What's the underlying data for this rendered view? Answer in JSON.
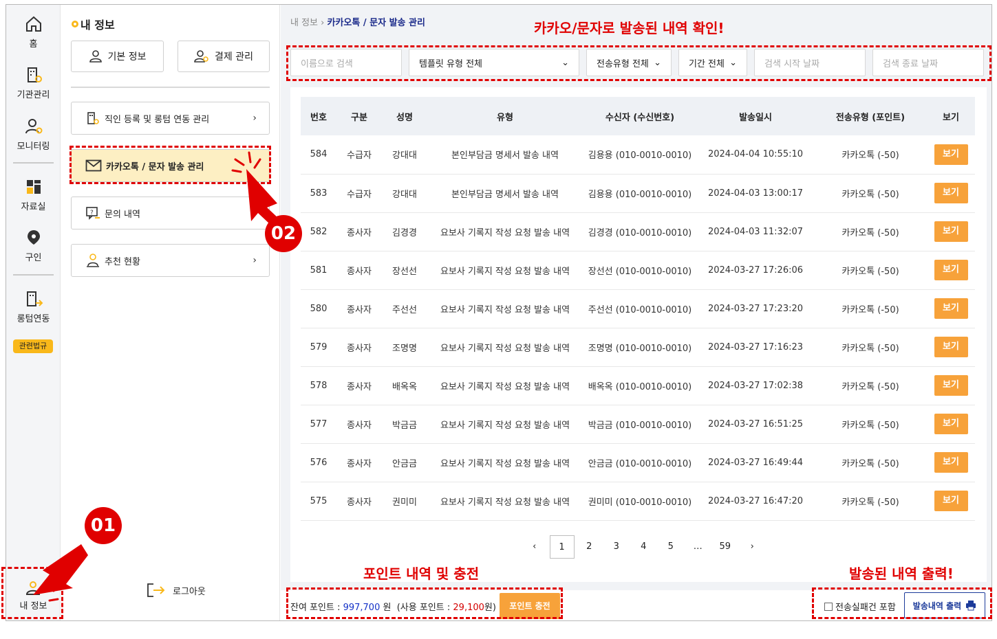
{
  "nav": {
    "home": "홈",
    "institution": "기관관리",
    "monitoring": "모니터링",
    "archive": "자료실",
    "jobs": "구인",
    "ltc_link": "롱텀연동",
    "law_badge": "관련법규",
    "my_info": "내 정보"
  },
  "side": {
    "title": "내 정보",
    "basic_info": "기본 정보",
    "payment": "결제 관리",
    "menu": [
      "직인 등록 및 롱텀 연동 관리",
      "카카오톡 / 문자 발송 관리",
      "문의 내역",
      "추천 현황"
    ],
    "logout": "로그아웃"
  },
  "breadcrumb": {
    "root": "내 정보",
    "current": "카카오톡 / 문자 발송 관리"
  },
  "filters": {
    "name_placeholder": "이름으로 검색",
    "template": "템플릿 유형 전체",
    "send_type": "전송유형 전체",
    "period": "기간 전체",
    "start_placeholder": "검색 시작 날짜",
    "end_placeholder": "검색 종료 날짜"
  },
  "table": {
    "headers": [
      "번호",
      "구분",
      "성명",
      "유형",
      "수신자 (수신번호)",
      "발송일시",
      "전송유형 (포인트)",
      "보기"
    ],
    "view_label": "보기",
    "rows": [
      [
        "584",
        "수급자",
        "강대대",
        "본인부담금 명세서 발송 내역",
        "김용용 (010-0010-0010)",
        "2024-04-04 10:55:10",
        "카카오톡 (-50)"
      ],
      [
        "583",
        "수급자",
        "강대대",
        "본인부담금 명세서 발송 내역",
        "김용용 (010-0010-0010)",
        "2024-04-03 13:00:17",
        "카카오톡 (-50)"
      ],
      [
        "582",
        "종사자",
        "김경경",
        "요보사 기록지 작성 요청 발송 내역",
        "김경경 (010-0010-0010)",
        "2024-04-03 11:32:07",
        "카카오톡 (-50)"
      ],
      [
        "581",
        "종사자",
        "장선선",
        "요보사 기록지 작성 요청 발송 내역",
        "장선선 (010-0010-0010)",
        "2024-03-27 17:26:06",
        "카카오톡 (-50)"
      ],
      [
        "580",
        "종사자",
        "주선선",
        "요보사 기록지 작성 요청 발송 내역",
        "주선선 (010-0010-0010)",
        "2024-03-27 17:23:20",
        "카카오톡 (-50)"
      ],
      [
        "579",
        "종사자",
        "조명명",
        "요보사 기록지 작성 요청 발송 내역",
        "조명명 (010-0010-0010)",
        "2024-03-27 17:16:23",
        "카카오톡 (-50)"
      ],
      [
        "578",
        "종사자",
        "배옥옥",
        "요보사 기록지 작성 요청 발송 내역",
        "배옥옥 (010-0010-0010)",
        "2024-03-27 17:02:38",
        "카카오톡 (-50)"
      ],
      [
        "577",
        "종사자",
        "박금금",
        "요보사 기록지 작성 요청 발송 내역",
        "박금금 (010-0010-0010)",
        "2024-03-27 16:51:25",
        "카카오톡 (-50)"
      ],
      [
        "576",
        "종사자",
        "안금금",
        "요보사 기록지 작성 요청 발송 내역",
        "안금금 (010-0010-0010)",
        "2024-03-27 16:49:44",
        "카카오톡 (-50)"
      ],
      [
        "575",
        "종사자",
        "권미미",
        "요보사 기록지 작성 요청 발송 내역",
        "권미미 (010-0010-0010)",
        "2024-03-27 16:47:20",
        "카카오톡 (-50)"
      ]
    ]
  },
  "pager": {
    "prev": "‹",
    "pages": [
      "1",
      "2",
      "3",
      "4",
      "5",
      "…",
      "59"
    ],
    "next": "›",
    "current": "1"
  },
  "bottom": {
    "remain_label": "잔여 포인트 :",
    "remain_value": "997,700",
    "unit": "원",
    "used_label": "(사용 포인트 :",
    "used_value": "29,100",
    "used_unit": "원)",
    "charge_btn": "포인트 충전",
    "include_failed": "전송실패건 포함",
    "print_btn": "발송내역 출력"
  },
  "annotations": {
    "top": "카카오/문자로 발송된 내역 확인!",
    "points": "포인트 내역 및 충전",
    "print": "발송된 내역 출력!",
    "step1": "01",
    "step2": "02"
  },
  "colors": {
    "accent": "#f7a23a",
    "highlight": "#fdefc3",
    "annotation": "#e00000",
    "brand": "#1b2a8a"
  }
}
